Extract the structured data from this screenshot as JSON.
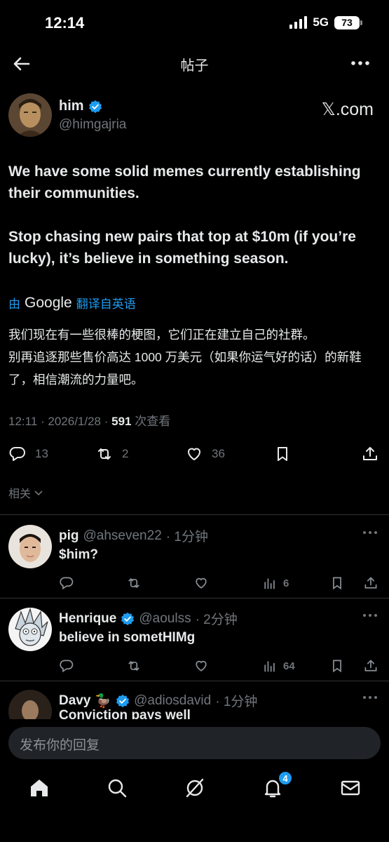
{
  "status_bar": {
    "time": "12:14",
    "network": "5G",
    "battery": "73"
  },
  "header": {
    "title": "帖子"
  },
  "post": {
    "author_name": "him",
    "author_handle": "@himgajria",
    "source": "𝕏.com",
    "paragraph_1": "We have some solid memes currently establishing their communities.",
    "paragraph_2": "Stop chasing new pairs that top at $10m (if you’re lucky), it’s believe in something season.",
    "translate_prefix": "由",
    "translate_brand": "Google",
    "translate_suffix": "翻译自英语",
    "translated_1": "我们现在有一些很棒的梗图，它们正在建立自己的社群。",
    "translated_2": "别再追逐那些售价高达 1000 万美元（如果你运气好的话）的新鞋了，相信潮流的力量吧。",
    "meta_time": "12:11 · 2026/1/28 · ",
    "meta_views": "591",
    "meta_views_label": " 次查看",
    "replies": "13",
    "reposts": "2",
    "likes": "36"
  },
  "related_label": "相关",
  "replies": [
    {
      "name": "pig",
      "emoji": "",
      "verified": false,
      "handle": "@ahseven22",
      "time": "· 1分钟",
      "text": "$him?",
      "views": "6"
    },
    {
      "name": "Henrique",
      "emoji": "",
      "verified": true,
      "handle": "@aoulss",
      "time": "· 2分钟",
      "text": "believe in sometHIMg",
      "views": "64"
    },
    {
      "name": "Davy",
      "emoji": "🦆",
      "verified": true,
      "handle": "@adiosdavid",
      "time": "· 1分钟",
      "text": "Conviction pays well",
      "views": ""
    }
  ],
  "reply_box": {
    "placeholder": "发布你的回复"
  },
  "nav": {
    "notifications_badge": "4"
  },
  "colors": {
    "accent": "#1d9bf0",
    "muted": "#71767b",
    "background": "#000000"
  }
}
